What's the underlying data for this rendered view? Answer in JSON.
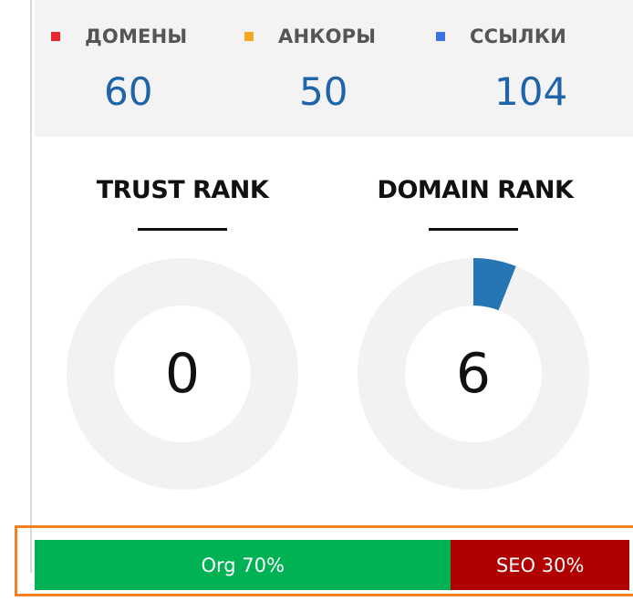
{
  "stats": [
    {
      "label": "ДОМЕНЫ",
      "value": "60",
      "color": "#e8262f"
    },
    {
      "label": "АНКОРЫ",
      "value": "50",
      "color": "#f5a623"
    },
    {
      "label": "ССЫЛКИ",
      "value": "104",
      "color": "#3b73e6"
    }
  ],
  "ranks": {
    "trust": {
      "title": "TRUST RANK",
      "value": "0",
      "percent": 0
    },
    "domain": {
      "title": "DOMAIN RANK",
      "value": "6",
      "percent": 6
    }
  },
  "gauge_colors": {
    "track": "#f2f2f2",
    "fill": "#2776b4"
  },
  "traffic": {
    "org": {
      "label": "Org 70%",
      "percent": 70,
      "color": "#00b254"
    },
    "seo": {
      "label": "SEO 30%",
      "percent": 30,
      "color": "#b00000"
    }
  }
}
